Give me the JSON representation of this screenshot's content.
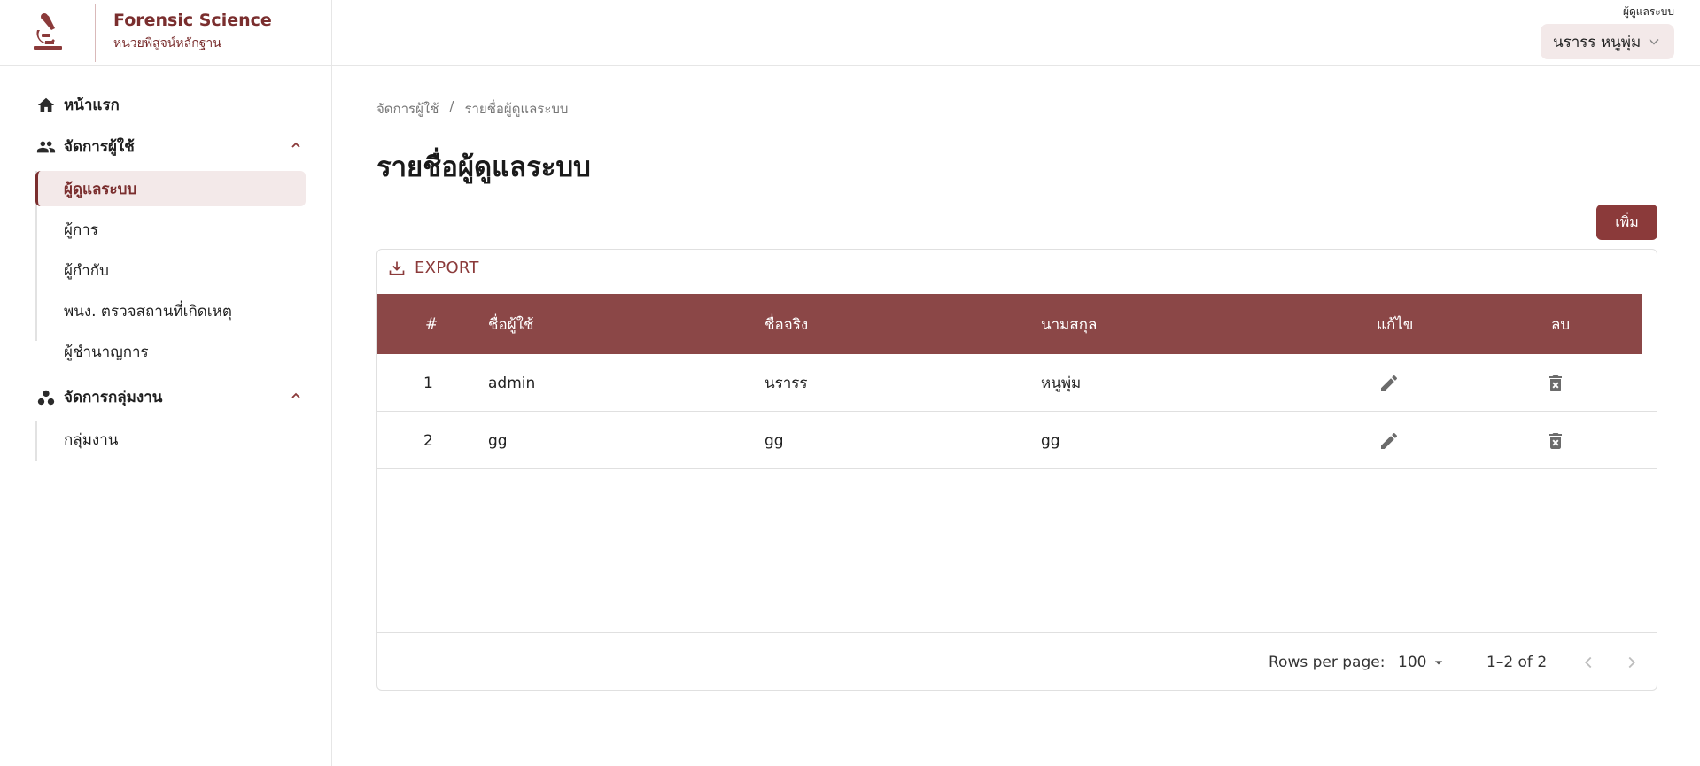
{
  "header": {
    "brand_title": "Forensic Science",
    "brand_subtitle": "หน่วยพิสูจน์หลักฐาน",
    "role_label": "ผู้ดูแลระบบ",
    "user_name": "นรารร หนูพุ่ม",
    "accent_color": "#7a2e2e"
  },
  "sidebar": {
    "home": "หน้าแรก",
    "user_group_label": "จัดการผู้ใช้",
    "user_items": [
      "ผู้ดูแลระบบ",
      "ผู้การ",
      "ผู้กำกับ",
      "พนง. ตรวจสถานที่เกิดเหตุ",
      "ผู้ชำนาญการ"
    ],
    "work_group_label": "จัดการกลุ่มงาน",
    "work_items": [
      "กลุ่มงาน"
    ]
  },
  "main": {
    "breadcrumb": [
      "จัดการผู้ใช้",
      "/",
      "รายชื่อผู้ดูแลระบบ"
    ],
    "title": "รายชื่อผู้ดูแลระบบ",
    "add_label": "เพิ่ม",
    "export_label": "EXPORT",
    "columns": [
      "#",
      "ชื่อผู้ใช้",
      "ชื่อจริง",
      "นามสกุล",
      "แก้ไข",
      "ลบ"
    ],
    "rows": [
      {
        "no": "1",
        "username": "admin",
        "firstname": "นรารร",
        "lastname": "หนูพุ่ม"
      },
      {
        "no": "2",
        "username": "gg",
        "firstname": "gg",
        "lastname": "gg"
      }
    ],
    "footer": {
      "rows_per_page_label": "Rows per page:",
      "rows_per_page_value": "100",
      "range_text": "1–2 of 2"
    },
    "header_color": "#8b4747"
  }
}
